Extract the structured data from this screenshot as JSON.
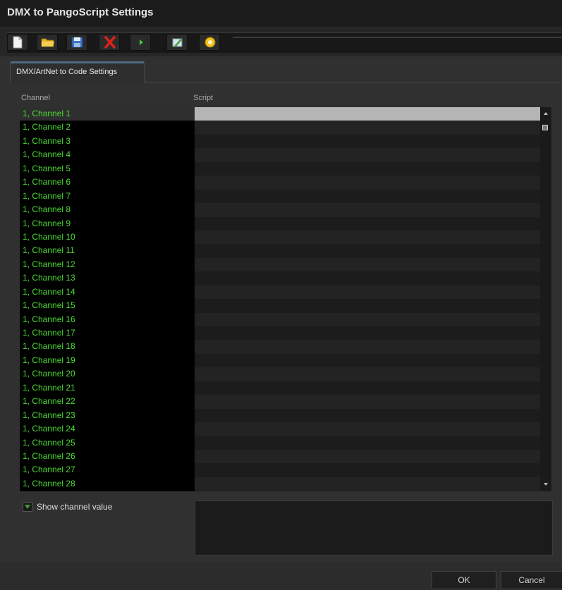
{
  "window": {
    "title": "DMX to PangoScript Settings"
  },
  "toolbar": {
    "buttons": [
      {
        "name": "new-icon"
      },
      {
        "name": "open-folder-icon"
      },
      {
        "name": "save-icon"
      },
      {
        "name": "delete-icon"
      },
      {
        "name": "play-icon"
      },
      {
        "name": "edit-icon"
      },
      {
        "name": "help-icon"
      }
    ]
  },
  "tabs": {
    "active_label": "DMX/ArtNet to Code Settings"
  },
  "table": {
    "channel_header": "Channel",
    "script_header": "Script",
    "channels": [
      "1, Channel 1",
      "1, Channel 2",
      "1, Channel 3",
      "1, Channel 4",
      "1, Channel 5",
      "1, Channel 6",
      "1, Channel 7",
      "1, Channel 8",
      "1, Channel 9",
      "1, Channel 10",
      "1, Channel 11",
      "1, Channel 12",
      "1, Channel 13",
      "1, Channel 14",
      "1, Channel 15",
      "1, Channel 16",
      "1, Channel 17",
      "1, Channel 18",
      "1, Channel 19",
      "1, Channel 20",
      "1, Channel 21",
      "1, Channel 22",
      "1, Channel 23",
      "1, Channel 24",
      "1, Channel 25",
      "1, Channel 26",
      "1, Channel 27",
      "1, Channel 28"
    ],
    "selected_index": 0
  },
  "options": {
    "show_channel_value_label": "Show channel value",
    "show_channel_value_checked": true
  },
  "buttons": {
    "ok_label": "OK",
    "cancel_label": "Cancel"
  },
  "colors": {
    "channel_text": "#4bdc33",
    "selected_script_row": "#b5b5b5",
    "tab_accent": "#4f6a86"
  }
}
